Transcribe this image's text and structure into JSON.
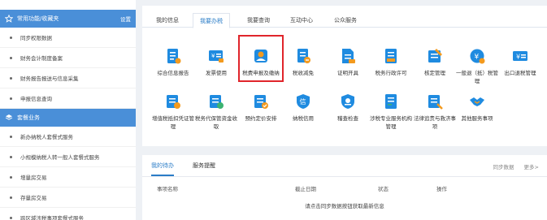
{
  "sidebar": {
    "favorites": {
      "title": "常用功能/收藏夹",
      "action": "设置",
      "items": [
        "同步权限数据",
        "财务会计制度备案",
        "财务报告报送与信息采集",
        "申报信息查询"
      ]
    },
    "packages": {
      "title": "套餐业务",
      "items": [
        "新办纳税人套餐式服务",
        "小规模纳税人转一般人套餐式服务",
        "增量房交易",
        "存量房交易",
        "跨区域涉税事项套餐式服务"
      ]
    }
  },
  "main": {
    "tabs": [
      "我的信息",
      "我要办税",
      "我要查询",
      "互动中心",
      "公众服务"
    ],
    "active_tab": "我要办税",
    "row1": [
      {
        "label": "综合信息报告",
        "icon": "report-icon"
      },
      {
        "label": "发票使用",
        "icon": "invoice-icon"
      },
      {
        "label": "税费申报及缴纳",
        "icon": "tax-declare-icon"
      },
      {
        "label": "税收减免",
        "icon": "tax-relief-icon"
      },
      {
        "label": "证明开具",
        "icon": "certificate-icon"
      },
      {
        "label": "税务行政许可",
        "icon": "license-icon"
      },
      {
        "label": "核定管理",
        "icon": "verify-icon"
      },
      {
        "label": "一般退（抵）税管理",
        "icon": "refund-icon"
      },
      {
        "label": "出口退税管理",
        "icon": "export-refund-icon"
      }
    ],
    "row2": [
      {
        "label": "增值税抵扣凭证管理",
        "icon": "vat-voucher-icon"
      },
      {
        "label": "税务代保管资金收取",
        "icon": "custody-fund-icon"
      },
      {
        "label": "预约定价安排",
        "icon": "pricing-icon"
      },
      {
        "label": "纳税信用",
        "icon": "credit-icon"
      },
      {
        "label": "稽查检查",
        "icon": "inspection-icon"
      },
      {
        "label": "涉税专业服务机构管理",
        "icon": "agency-icon"
      },
      {
        "label": "法律追责与救济事项",
        "icon": "legal-icon"
      },
      {
        "label": "其他服务事项",
        "icon": "handshake-icon"
      }
    ],
    "colors": {
      "accent": "#2a7cc7",
      "highlight": "#e0252b",
      "icon_blue": "#1f8be0",
      "icon_orange": "#f39a1e"
    }
  },
  "bottom": {
    "tabs": [
      "我的待办",
      "服务提醒"
    ],
    "sync": "同步数据",
    "more": "更多>",
    "headers": [
      "事项名称",
      "截止日期",
      "状态",
      "操作"
    ],
    "message": "请点击同步数据按钮获取最新信息"
  }
}
